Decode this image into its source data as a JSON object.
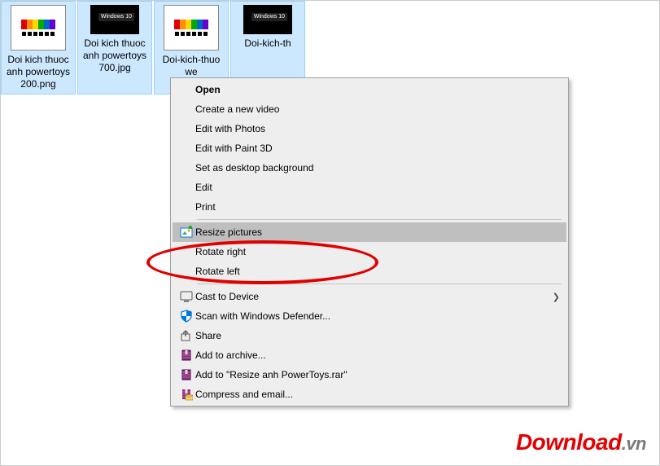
{
  "files": [
    {
      "label": "Doi kich thuoc anh powertoys 200.png",
      "big": true,
      "badge": ""
    },
    {
      "label": "Doi kich thuoc anh powertoys 700.jpg",
      "big": false,
      "badge": "Windows 10"
    },
    {
      "label": "Doi-kich-thuo",
      "big": true,
      "badge": "",
      "truncatedExtra": "we"
    },
    {
      "label": "Doi-kich-th",
      "big": false,
      "badge": "Windows 10"
    }
  ],
  "menu": {
    "open": "Open",
    "create_video": "Create a new video",
    "edit_photos": "Edit with Photos",
    "edit_paint3d": "Edit with Paint 3D",
    "set_bg": "Set as desktop background",
    "edit": "Edit",
    "print": "Print",
    "resize": "Resize pictures",
    "rotate_right": "Rotate right",
    "rotate_left": "Rotate left",
    "cast": "Cast to Device",
    "defender": "Scan with Windows Defender...",
    "share": "Share",
    "add_archive": "Add to archive...",
    "add_rar": "Add to \"Resize anh PowerToys.rar\"",
    "compress_email": "Compress and email..."
  },
  "watermark": {
    "main": "Download",
    "suffix": ".vn"
  }
}
